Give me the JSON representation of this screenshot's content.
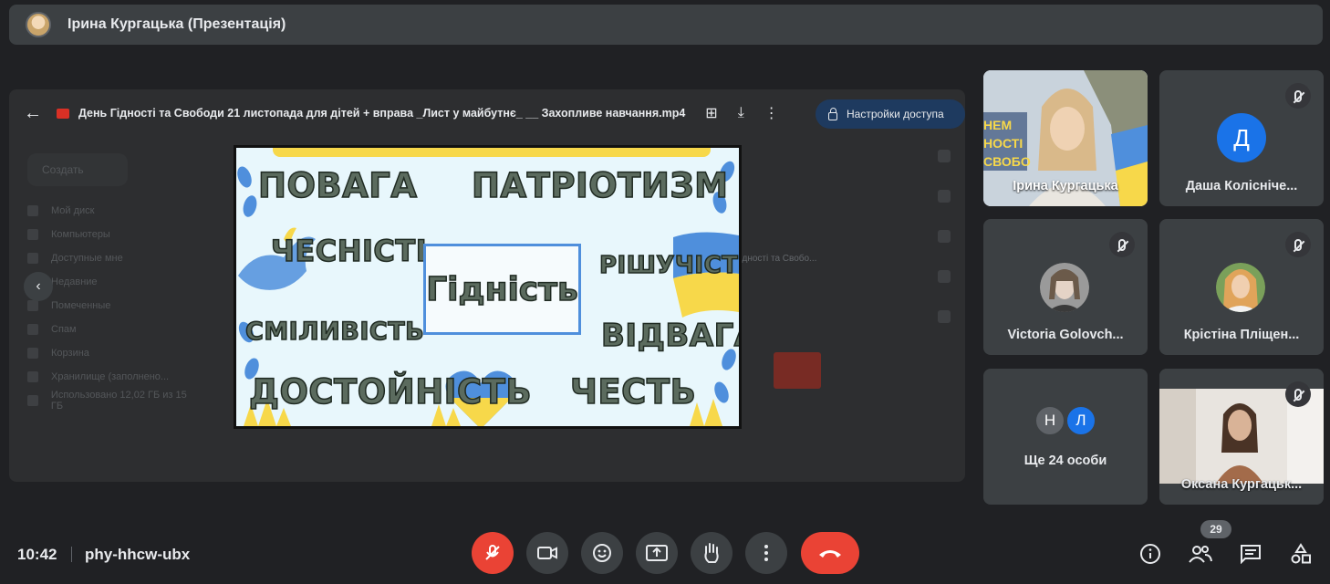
{
  "presentation_bar": {
    "title": "Ірина Кургацька (Презентація)"
  },
  "stage": {
    "file_title": "День Гідності та Свободи 21 листопада для дітей + вправа _Лист у майбутнє_ __ Захопливе навчання.mp4",
    "access_button": "Настройки доступа",
    "background_drive": {
      "create": "Создать",
      "items": [
        "Мой диск",
        "Компьютеры",
        "Доступные мне",
        "Недавние",
        "Помеченные",
        "Спам",
        "Корзина",
        "Хранилище (заполнено...",
        "Использовано 12,02 ГБ из 15 ГБ"
      ],
      "file_name": "День Гідності та Свобо..."
    }
  },
  "slide": {
    "words": [
      "ПОВАГА",
      "ПАТРІОТИЗМ",
      "ЧЕСНІСТЬ",
      "РІШУЧІСТЬ",
      "СМІЛИВІСТЬ",
      "ВІДВАГА",
      "ДОСТОЙНІСТЬ",
      "ЧЕСТЬ"
    ],
    "center": "Гідність",
    "colors": {
      "blue": "#4f8fdc",
      "yellow": "#f7d84a",
      "text": "#5b6b5e"
    }
  },
  "participants": [
    {
      "name": "Ірина Кургацька",
      "muted": false,
      "banner": "НЕМ\nНОСТІ\nСВОБО"
    },
    {
      "name": "Даша Колісніче...",
      "muted": true,
      "initial": "Д",
      "color": "#1a73e8"
    },
    {
      "name": "Victoria Golovch...",
      "muted": true
    },
    {
      "name": "Крістіна Пліщен...",
      "muted": true
    },
    {
      "name": "Ще 24 особи",
      "muted": false,
      "initials": [
        "Н",
        "Л"
      ]
    },
    {
      "name": "Оксана Кургацьк...",
      "muted": true
    }
  ],
  "bottombar": {
    "time": "10:42",
    "meeting_code": "phy-hhcw-ubx",
    "participant_count": "29",
    "icons": {
      "mic": "mic-off-icon",
      "camera": "videocam-icon",
      "reactions": "emoji-icon",
      "present": "present-to-all-icon",
      "hand": "raise-hand-icon",
      "more": "more-vert-icon",
      "end": "call-end-icon",
      "info": "info-icon",
      "people": "people-icon",
      "chat": "chat-icon",
      "activities": "activities-icon"
    }
  }
}
